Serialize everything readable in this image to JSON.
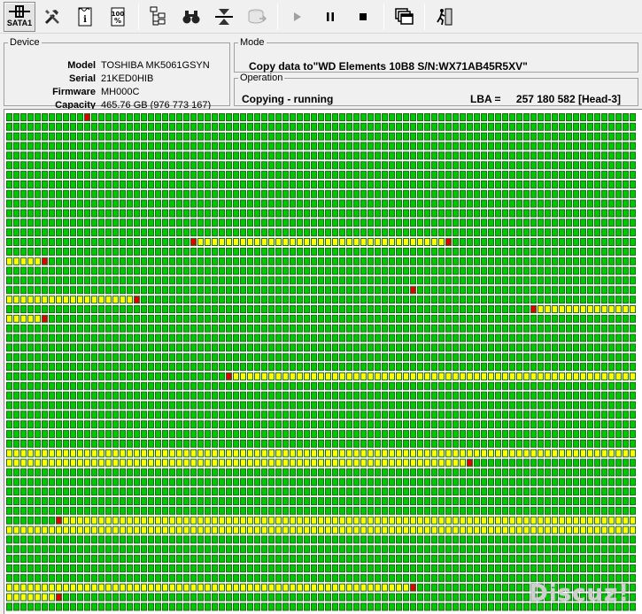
{
  "toolbar": {
    "interface_label": "SATA1",
    "buttons": [
      {
        "icon": "sata-port-icon"
      },
      {
        "icon": "tools-icon"
      },
      {
        "icon": "info-document-icon"
      },
      {
        "icon": "percent-stats-icon"
      },
      {
        "icon": "tree-structure-icon"
      },
      {
        "icon": "binoculars-icon"
      },
      {
        "icon": "copy-splitter-icon"
      },
      {
        "icon": "disk-export-icon"
      },
      {
        "icon": "play-icon"
      },
      {
        "icon": "pause-icon"
      },
      {
        "icon": "stop-icon"
      },
      {
        "icon": "windows-icon"
      },
      {
        "icon": "exit-icon"
      }
    ]
  },
  "device": {
    "legend": "Device",
    "fields": [
      {
        "label": "Model",
        "value": "TOSHIBA MK5061GSYN"
      },
      {
        "label": "Serial",
        "value": "21KED0HIB"
      },
      {
        "label": "Firmware",
        "value": "MH000C"
      },
      {
        "label": "Capacity",
        "value": "465.76 GB (976 773 167)"
      }
    ]
  },
  "mode": {
    "legend": "Mode",
    "text": "Copy data to\"WD Elements 10B8 S/N:WX71AB45R5XV\""
  },
  "operation": {
    "legend": "Operation",
    "status": "Copying - running",
    "lba_label": "LBA =",
    "lba_value": "257 180 582",
    "head": "[Head-3]"
  },
  "watermark": "Discuz!",
  "sector_map": {
    "columns": 89,
    "rows": 52,
    "colors": {
      "good": "#00c800",
      "pending": "#ffff00",
      "bad": "#e00000",
      "border": "#1a6e1a"
    },
    "yellow_spans": [
      {
        "row": 13,
        "from": 27,
        "to": 61
      },
      {
        "row": 15,
        "from": 0,
        "to": 4
      },
      {
        "row": 19,
        "from": 0,
        "to": 17
      },
      {
        "row": 20,
        "from": 75,
        "to": 88
      },
      {
        "row": 21,
        "from": 0,
        "to": 4
      },
      {
        "row": 27,
        "from": 32,
        "to": 88
      },
      {
        "row": 35,
        "from": 0,
        "to": 88
      },
      {
        "row": 36,
        "from": 0,
        "to": 64
      },
      {
        "row": 42,
        "from": 8,
        "to": 88
      },
      {
        "row": 43,
        "from": 0,
        "to": 88
      },
      {
        "row": 49,
        "from": 0,
        "to": 56
      },
      {
        "row": 50,
        "from": 0,
        "to": 6
      }
    ],
    "red_cells": [
      {
        "row": 0,
        "col": 11
      },
      {
        "row": 13,
        "col": 26
      },
      {
        "row": 13,
        "col": 62
      },
      {
        "row": 15,
        "col": 5
      },
      {
        "row": 18,
        "col": 57
      },
      {
        "row": 19,
        "col": 18
      },
      {
        "row": 20,
        "col": 74
      },
      {
        "row": 21,
        "col": 5
      },
      {
        "row": 27,
        "col": 31
      },
      {
        "row": 36,
        "col": 65
      },
      {
        "row": 42,
        "col": 7
      },
      {
        "row": 49,
        "col": 57
      },
      {
        "row": 50,
        "col": 7
      }
    ]
  }
}
